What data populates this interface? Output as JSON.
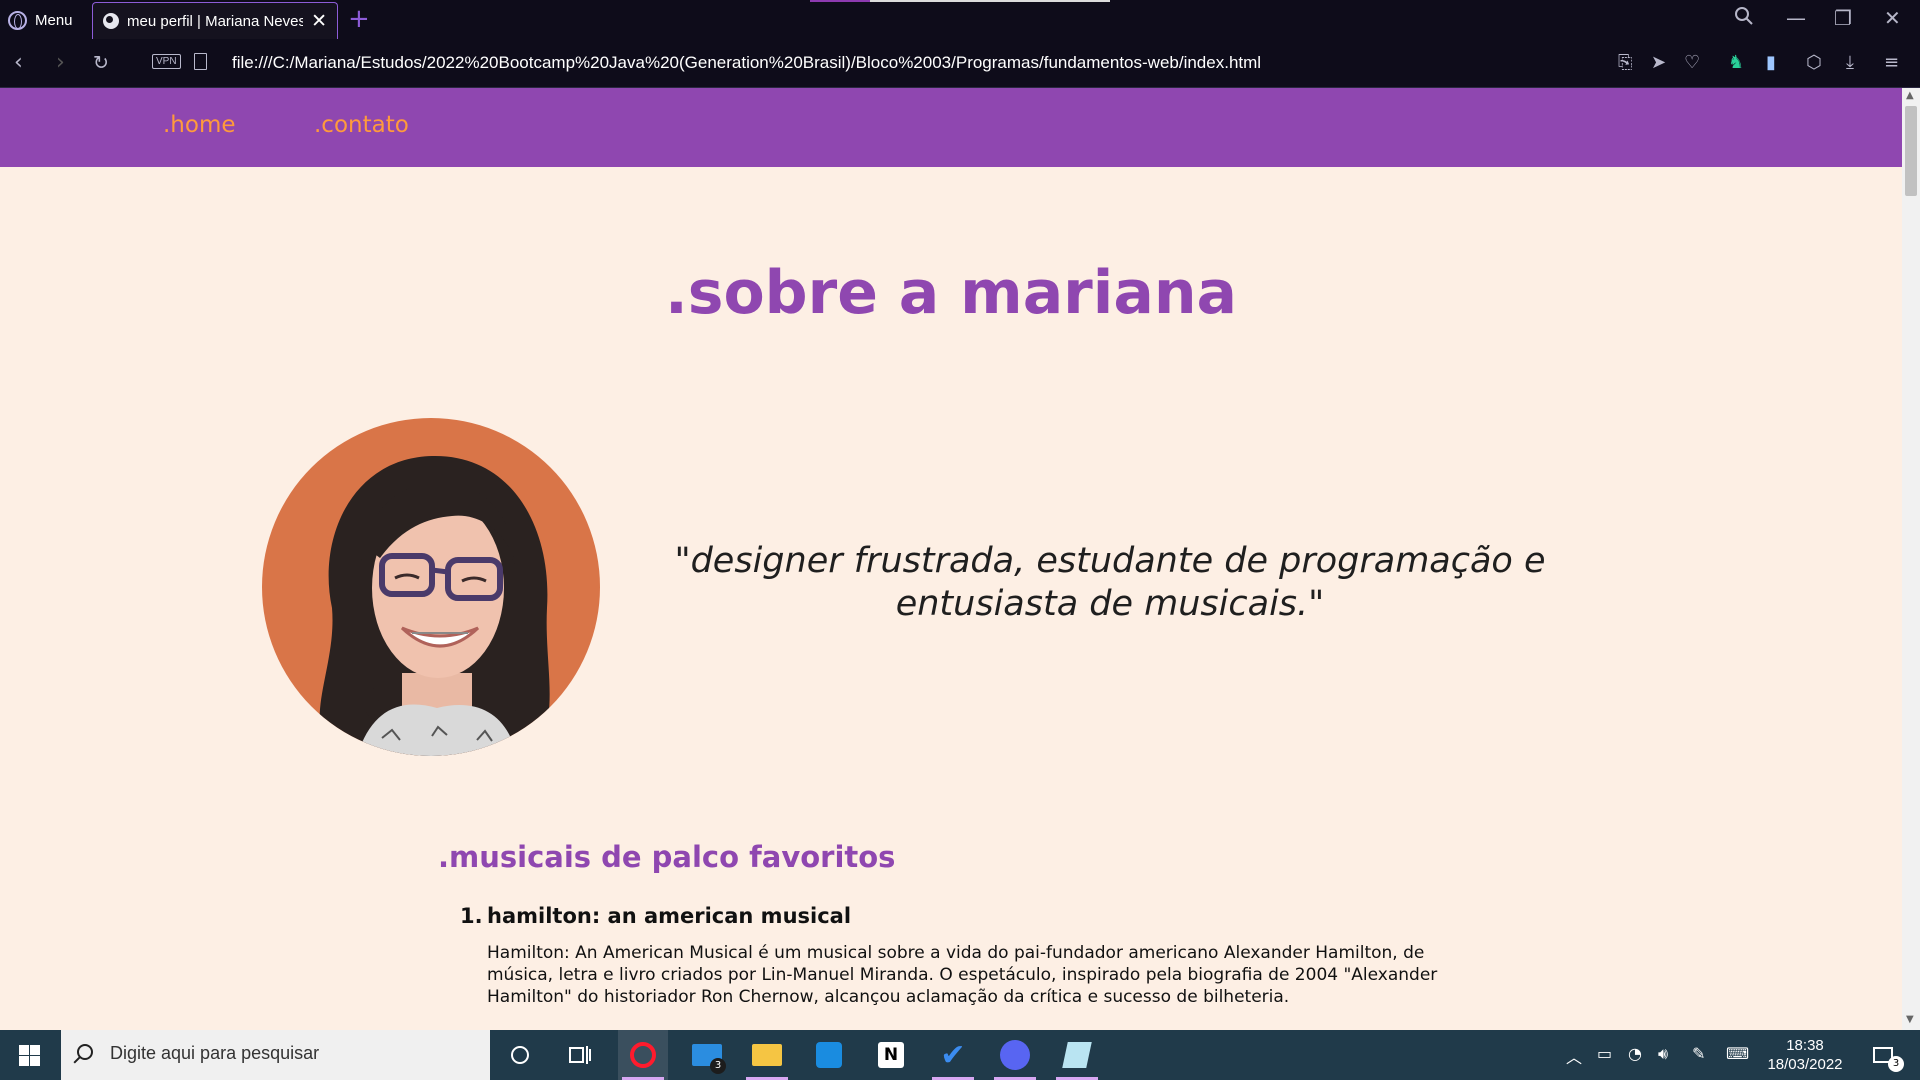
{
  "browser": {
    "menu_label": "Menu",
    "tab_title": "meu perfil | Mariana Neves",
    "url": "file:///C:/Mariana/Estudos/2022%20Bootcamp%20Java%20(Generation%20Brasil)/Bloco%2003/Programas/fundamentos-web/index.html",
    "vpn_label": "VPN"
  },
  "site": {
    "nav": [
      ".home",
      ".contato"
    ],
    "title": ".sobre a mariana",
    "quote_line1": "\"designer frustrada, estudante de programação e",
    "quote_line2": "entusiasta de musicais.\"",
    "section_title": ".musicais de palco favoritos",
    "musicals": [
      {
        "number": "1.",
        "title": "hamilton: an american musical",
        "description": "Hamilton: An American Musical é um musical sobre a vida do pai-fundador americano Alexander Hamilton, de música, letra e livro criados por Lin-Manuel Miranda. O espetáculo, inspirado pela biografia de 2004 \"Alexander Hamilton\" do historiador Ron Chernow, alcançou aclamação da crítica e sucesso de bilheteria."
      }
    ]
  },
  "taskbar": {
    "search_placeholder": "Digite aqui para pesquisar",
    "mail_badge": "3",
    "time": "18:38",
    "date": "18/03/2022",
    "notifications_badge": "3"
  },
  "colors": {
    "accent_purple": "#8f47b0",
    "nav_link_orange": "#ff9a3c",
    "page_background": "#fdefe4",
    "avatar_background": "#d97548"
  }
}
